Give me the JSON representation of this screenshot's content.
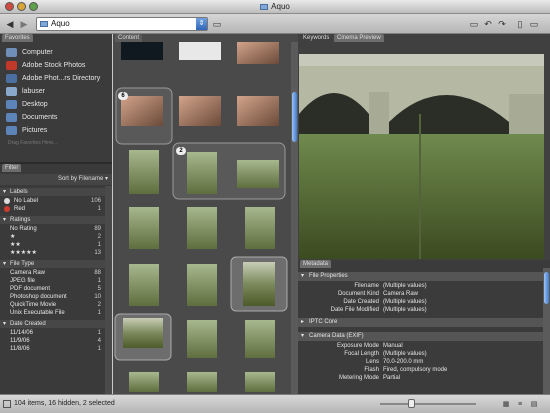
{
  "window": {
    "title": "Aquo"
  },
  "toolbar": {
    "path_value": "Aquo",
    "back_icon": "back-arrow",
    "forward_icon": "forward-arrow"
  },
  "panels": {
    "favorites_tab": "Favorites",
    "filter_tab": "Filter",
    "content_tab": "Content",
    "keywords_tab": "Keywords",
    "preview_tab": "Cinema Preview",
    "metadata_tab": "Metadata"
  },
  "favorites": {
    "items": [
      {
        "label": "Computer",
        "color": "#6f8fb9"
      },
      {
        "label": "Adobe Stock Photos",
        "color": "#c0392b"
      },
      {
        "label": "Adobe Phot...rs Directory",
        "color": "#4b6fa0"
      },
      {
        "label": "labuser",
        "color": "#8aa8cc"
      },
      {
        "label": "Desktop",
        "color": "#5c84b8"
      },
      {
        "label": "Documents",
        "color": "#5c84b8"
      },
      {
        "label": "Pictures",
        "color": "#5c84b8"
      }
    ],
    "hint": "Drag Favorites Here..."
  },
  "filter": {
    "sort_label": "Sort by Filename",
    "groups": [
      {
        "title": "Labels",
        "rows": [
          {
            "label": "No Label",
            "count": "106",
            "dot": "#dddddd"
          },
          {
            "label": "Red",
            "count": "1",
            "dot": "#d03a2e"
          }
        ]
      },
      {
        "title": "Ratings",
        "rows": [
          {
            "label": "No Rating",
            "count": "89"
          },
          {
            "label": "★",
            "count": "2"
          },
          {
            "label": "★★",
            "count": "1"
          },
          {
            "label": "★★★★★",
            "count": "13"
          }
        ]
      },
      {
        "title": "File Type",
        "rows": [
          {
            "label": "Camera Raw",
            "count": "88"
          },
          {
            "label": "JPEG file",
            "count": "1"
          },
          {
            "label": "PDF document",
            "count": "5"
          },
          {
            "label": "Photoshop document",
            "count": "10"
          },
          {
            "label": "QuickTime Movie",
            "count": "2"
          },
          {
            "label": "Unix Executable File",
            "count": "1"
          }
        ]
      },
      {
        "title": "Date Created",
        "rows": [
          {
            "label": "11/14/06",
            "count": "1"
          },
          {
            "label": "11/9/06",
            "count": "4"
          },
          {
            "label": "11/8/06",
            "count": "1"
          }
        ]
      }
    ]
  },
  "content": {
    "stack_badges": [
      "6",
      "2"
    ],
    "accent": "#3f79cf"
  },
  "metadata": {
    "sections": [
      {
        "title": "File Properties",
        "open": true,
        "rows": [
          {
            "key": "Filename",
            "value": "(Multiple values)"
          },
          {
            "key": "Document Kind",
            "value": "Camera Raw"
          },
          {
            "key": "Date Created",
            "value": "(Multiple values)"
          },
          {
            "key": "Date File Modified",
            "value": "(Multiple values)"
          }
        ]
      },
      {
        "title": "IPTC Core",
        "open": false,
        "rows": []
      },
      {
        "title": "Camera Data (EXIF)",
        "open": true,
        "rows": [
          {
            "key": "Exposure Mode",
            "value": "Manual"
          },
          {
            "key": "Focal Length",
            "value": "(Multiple values)"
          },
          {
            "key": "Lens",
            "value": "70.0-200.0 mm"
          },
          {
            "key": "Flash",
            "value": "Fired, compulsory mode"
          },
          {
            "key": "Metering Mode",
            "value": "Partial"
          }
        ]
      }
    ]
  },
  "status": {
    "text": "104 items, 16 hidden, 2 selected"
  }
}
